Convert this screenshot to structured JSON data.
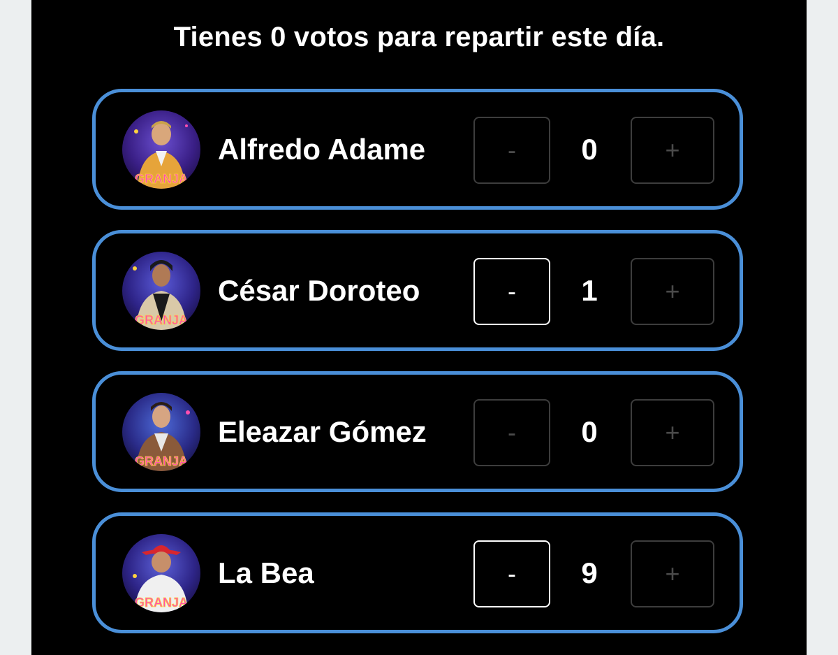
{
  "header": {
    "text": "Tienes 0 votos para repartir este día."
  },
  "contestants": [
    {
      "name": "Alfredo Adame",
      "votes": "0",
      "minus_label": "-",
      "plus_label": "+",
      "minus_enabled": false,
      "plus_enabled": false,
      "avatar_icon": "contestant-photo"
    },
    {
      "name": "César Doroteo",
      "votes": "1",
      "minus_label": "-",
      "plus_label": "+",
      "minus_enabled": true,
      "plus_enabled": false,
      "avatar_icon": "contestant-photo"
    },
    {
      "name": "Eleazar Gómez",
      "votes": "0",
      "minus_label": "-",
      "plus_label": "+",
      "minus_enabled": false,
      "plus_enabled": false,
      "avatar_icon": "contestant-photo"
    },
    {
      "name": "La Bea",
      "votes": "9",
      "minus_label": "-",
      "plus_label": "+",
      "minus_enabled": true,
      "plus_enabled": false,
      "avatar_icon": "contestant-photo"
    }
  ],
  "avatar_logo_text": "LA GRANJA",
  "colors": {
    "card_border": "#4a8fd8",
    "background": "#000000",
    "outer_background": "#eceff0",
    "button_disabled": "#3d3d3d",
    "button_enabled": "#ffffff",
    "text": "#ffffff"
  }
}
